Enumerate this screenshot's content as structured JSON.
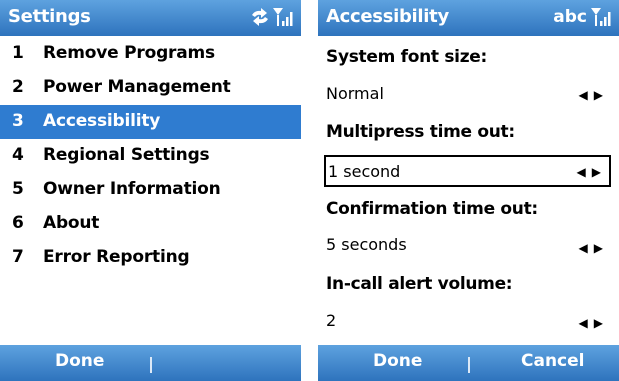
{
  "settings_screen": {
    "title": "Settings",
    "items": [
      {
        "num": "1",
        "label": "Remove Programs"
      },
      {
        "num": "2",
        "label": "Power Management"
      },
      {
        "num": "3",
        "label": "Accessibility"
      },
      {
        "num": "4",
        "label": "Regional Settings"
      },
      {
        "num": "5",
        "label": "Owner Information"
      },
      {
        "num": "6",
        "label": "About"
      },
      {
        "num": "7",
        "label": "Error Reporting"
      }
    ],
    "selected_index": 2,
    "softkey_left": "Done",
    "icons": [
      "sync-arrows-icon",
      "signal-strength-icon"
    ]
  },
  "accessibility_screen": {
    "title": "Accessibility",
    "input_mode": "abc",
    "fields": [
      {
        "label": "System font size:",
        "value": "Normal"
      },
      {
        "label": "Multipress time out:",
        "value": "1 second"
      },
      {
        "label": "Confirmation time out:",
        "value": "5 seconds"
      },
      {
        "label": "In-call alert volume:",
        "value": "2"
      }
    ],
    "focused_field_index": 1,
    "softkey_left": "Done",
    "softkey_right": "Cancel",
    "icons": [
      "signal-strength-icon",
      "left-arrow-icon",
      "right-arrow-icon"
    ]
  },
  "colors": {
    "titlebar_top": "#5ea2df",
    "titlebar_bottom": "#2e73bd",
    "selection": "#2f7cd0"
  }
}
